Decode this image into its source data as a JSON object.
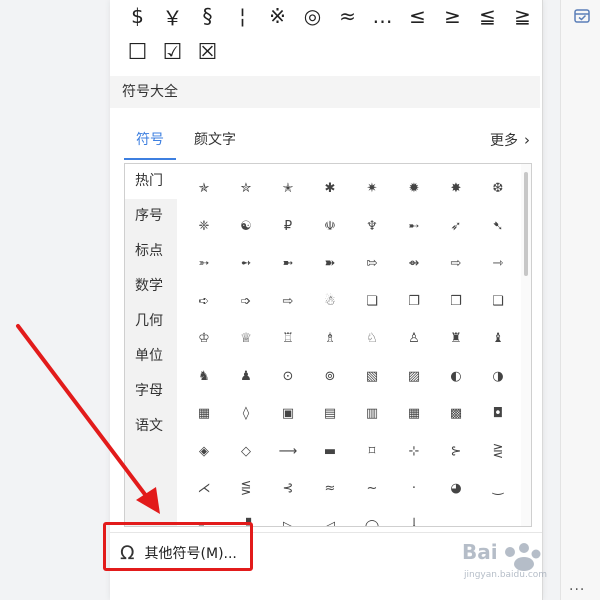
{
  "colors": {
    "accent": "#3d7fe0",
    "annotation": "#e21b1b"
  },
  "top_symbols": {
    "row1": [
      "$",
      "￥",
      "§",
      "¦",
      "※",
      "◎",
      "≈",
      "…",
      "≤",
      "≥",
      "≦",
      "≧"
    ],
    "row2": [
      "☐",
      "☑",
      "☒"
    ]
  },
  "section_title": "符号大全",
  "tabs": {
    "symbols": "符号",
    "emoticons": "颜文字",
    "more": "更多"
  },
  "categories": [
    "热门",
    "序号",
    "标点",
    "数学",
    "几何",
    "单位",
    "字母",
    "语文"
  ],
  "symbols": [
    "✯",
    "✮",
    "✭",
    "✱",
    "✷",
    "✹",
    "✸",
    "❆",
    "❈",
    "☯",
    "₽",
    "☫",
    "♆",
    "➸",
    "➶",
    "➷",
    "➳",
    "➻",
    "➼",
    "➽",
    "⇰",
    "⇴",
    "⇨",
    "⇾",
    "➪",
    "➩",
    "⇨",
    "☃",
    "❏",
    "❐",
    "❒",
    "❑",
    "♔",
    "♕",
    "♖",
    "♗",
    "♘",
    "♙",
    "♜",
    "♝",
    "♞",
    "♟",
    "⊙",
    "⊚",
    "▧",
    "▨",
    "◐",
    "◑",
    "▦",
    "◊",
    "▣",
    "▤",
    "▥",
    "▦",
    "▩",
    "◘",
    "◈",
    "◇",
    "⟶",
    "▬",
    "⌑",
    "⊹",
    "⊱",
    "⋛",
    "⋌",
    "⋚",
    "⊰",
    "≈",
    "~",
    "·",
    "◕",
    "‿",
    "▖",
    "▝",
    "▷",
    "◁",
    "◯",
    "╽"
  ],
  "other_symbols_label": "其他符号(M)...",
  "watermark": {
    "brand": "Bai",
    "url": "jingyan.baidu.com"
  },
  "side_dots": "···"
}
